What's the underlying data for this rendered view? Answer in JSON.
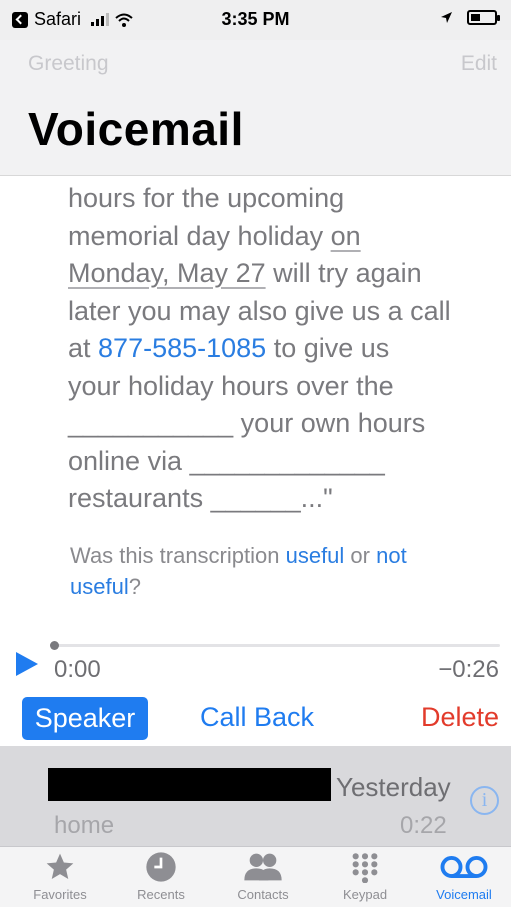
{
  "status_bar": {
    "carrier": "Safari",
    "time": "3:35 PM"
  },
  "nav": {
    "left_label": "Greeting",
    "right_label": "Edit",
    "title": "Voicemail"
  },
  "transcription": {
    "line1": "hours for the upcoming",
    "line2a": "memorial day holiday ",
    "line2b": "on",
    "line3a": "Monday, May 27",
    "line3b": " will try again",
    "line4": "later you may also give us a call",
    "line5a": "at ",
    "line5_phone": "877-585-1085",
    "line5b": " to give us",
    "line6": "your holiday hours over the",
    "line7": "___________ your own hours",
    "line8": "online via _____________",
    "line9": "restaurants ______...\""
  },
  "feedback": {
    "prefix": "Was this transcription ",
    "useful": "useful",
    "middle": " or ",
    "not_useful_1": "not",
    "not_useful_2": "useful",
    "suffix": "?"
  },
  "player": {
    "elapsed": "0:00",
    "remaining": "−0:26",
    "progress": 0.0
  },
  "actions": {
    "speaker": "Speaker",
    "call_back": "Call Back",
    "delete": "Delete"
  },
  "next_voicemail": {
    "date": "Yesterday",
    "label": "home",
    "duration": "0:22"
  },
  "tabs": [
    {
      "label": "Favorites",
      "icon": "star-icon"
    },
    {
      "label": "Recents",
      "icon": "clock-icon"
    },
    {
      "label": "Contacts",
      "icon": "contacts-icon"
    },
    {
      "label": "Keypad",
      "icon": "keypad-icon"
    },
    {
      "label": "Voicemail",
      "icon": "voicemail-icon",
      "active": true
    }
  ],
  "colors": {
    "accent": "#1f7cf0",
    "destructive": "#e23b2b"
  }
}
